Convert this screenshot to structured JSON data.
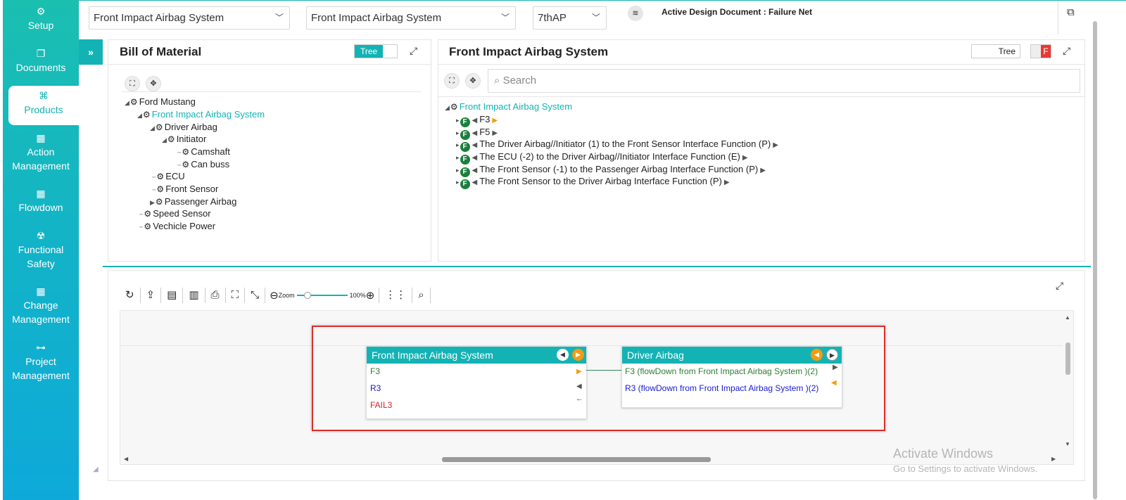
{
  "sidebar": {
    "items": [
      {
        "label": "Setup",
        "icon": "gears-icon"
      },
      {
        "label": "Documents",
        "icon": "documents-icon"
      },
      {
        "label": "Products",
        "icon": "products-icon"
      },
      {
        "label": "Action Management",
        "icon": "building-icon"
      },
      {
        "label": "Flowdown",
        "icon": "building-icon"
      },
      {
        "label": "Functional Safety",
        "icon": "safety-icon"
      },
      {
        "label": "Change Management",
        "icon": "building-icon"
      },
      {
        "label": "Project Management",
        "icon": "hierarchy-icon"
      }
    ],
    "active": "Products",
    "collapse_glyph": "»"
  },
  "topbar": {
    "select1": "Front Impact Airbag System",
    "select2": "Front Impact Airbag System",
    "select3": "7thAP",
    "active_doc": "Active Design Document : Failure Net"
  },
  "bom": {
    "title": "Bill of Material",
    "toggle_label": "Tree",
    "tree": [
      {
        "label": "Ford Mustang",
        "selected": false
      },
      {
        "label": "Front Impact Airbag System",
        "selected": true
      },
      {
        "label": "Driver Airbag",
        "selected": false
      },
      {
        "label": "Initiator",
        "selected": false
      },
      {
        "label": "Camshaft",
        "selected": false
      },
      {
        "label": "Can buss",
        "selected": false
      },
      {
        "label": "ECU",
        "selected": false
      },
      {
        "label": "Front Sensor",
        "selected": false
      },
      {
        "label": "Passenger Airbag",
        "selected": false
      },
      {
        "label": "Speed Sensor",
        "selected": false
      },
      {
        "label": "Vechicle Power",
        "selected": false
      }
    ]
  },
  "function_panel": {
    "title": "Front Impact Airbag System",
    "toggle_label": "Tree",
    "f_toggle": "F",
    "search_placeholder": "Search",
    "root": "Front Impact Airbag System",
    "badge": "F",
    "functions": [
      "F3",
      "F5",
      "The Driver Airbag//Initiator (1) to the Front Sensor Interface Function (P)",
      "The ECU (-2) to the Driver Airbag//Initiator Interface Function (E)",
      "The Front Sensor (-1) to the Passenger Airbag Interface Function (P)",
      "The Front Sensor to the Driver Airbag Interface Function (P)"
    ]
  },
  "diagram": {
    "zoom_label": "Zoom",
    "zoom_value": "100%",
    "zoom_level": 0.1,
    "node1": {
      "title": "Front Impact Airbag System",
      "rows": [
        {
          "text": "F3",
          "color": "#2e7d32"
        },
        {
          "text": "R3",
          "color": "#1a1ad0"
        },
        {
          "text": "FAIL3",
          "color": "#e02020"
        }
      ]
    },
    "node2": {
      "title": "Driver Airbag",
      "rows": [
        {
          "text": "F3 (flowDown from Front Impact Airbag System )(2)",
          "color": "#2e7d32"
        },
        {
          "text": "R3 (flowDown from Front Impact Airbag System )(2)",
          "color": "#1a1ad0"
        }
      ]
    }
  },
  "watermark": {
    "line1": "Activate Windows",
    "line2": "Go to Settings to activate Windows."
  }
}
